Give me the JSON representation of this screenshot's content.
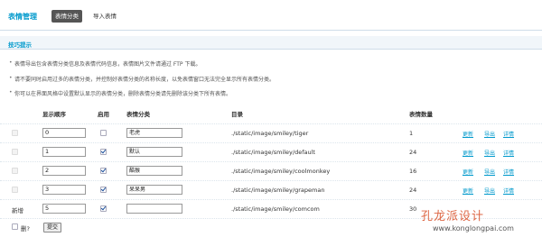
{
  "header": {
    "title": "表情管理",
    "tabs": [
      {
        "label": "表情分类",
        "active": true
      },
      {
        "label": "导入表情",
        "active": false
      }
    ]
  },
  "tips": {
    "title": "技巧提示",
    "items": [
      "表情导出包含表情分类信息及表情代码信息，表情图片文件请通过 FTP 下载。",
      "请不要同时启用过多的表情分类，并控制好表情分类的名称长度，以免表情窗口无法完全显示所有表情分类。",
      "你可以在界面风格中设置默认显示的表情分类，删除表情分类请先删除该分类下所有表情。"
    ]
  },
  "table": {
    "columns": [
      "显示顺序",
      "启用",
      "表情分类",
      "目录",
      "表情数量"
    ],
    "rows": [
      {
        "order": "0",
        "enabled": false,
        "name": "老虎",
        "dir": "./static/image/smiley/tiger",
        "count": "1",
        "links": [
          "更新",
          "导出",
          "详情"
        ]
      },
      {
        "order": "1",
        "enabled": true,
        "name": "默认",
        "dir": "./static/image/smiley/default",
        "count": "24",
        "links": [
          "更新",
          "导出",
          "详情"
        ]
      },
      {
        "order": "2",
        "enabled": true,
        "name": "酷猴",
        "dir": "./static/image/smiley/coolmonkey",
        "count": "16",
        "links": [
          "更新",
          "导出",
          "详情"
        ]
      },
      {
        "order": "3",
        "enabled": true,
        "name": "呆呆男",
        "dir": "./static/image/smiley/grapeman",
        "count": "24",
        "links": [
          "更新",
          "导出",
          "详情"
        ]
      }
    ],
    "new_row": {
      "label": "新增",
      "order": "5",
      "enabled": true,
      "name": "",
      "dir": "./static/image/smiley/comcom",
      "count": "30"
    }
  },
  "footer": {
    "delete_label": "删?",
    "submit_label": "提交"
  },
  "watermark": {
    "cn": "孔龙派设计",
    "en": "www.konglongpai.com"
  }
}
